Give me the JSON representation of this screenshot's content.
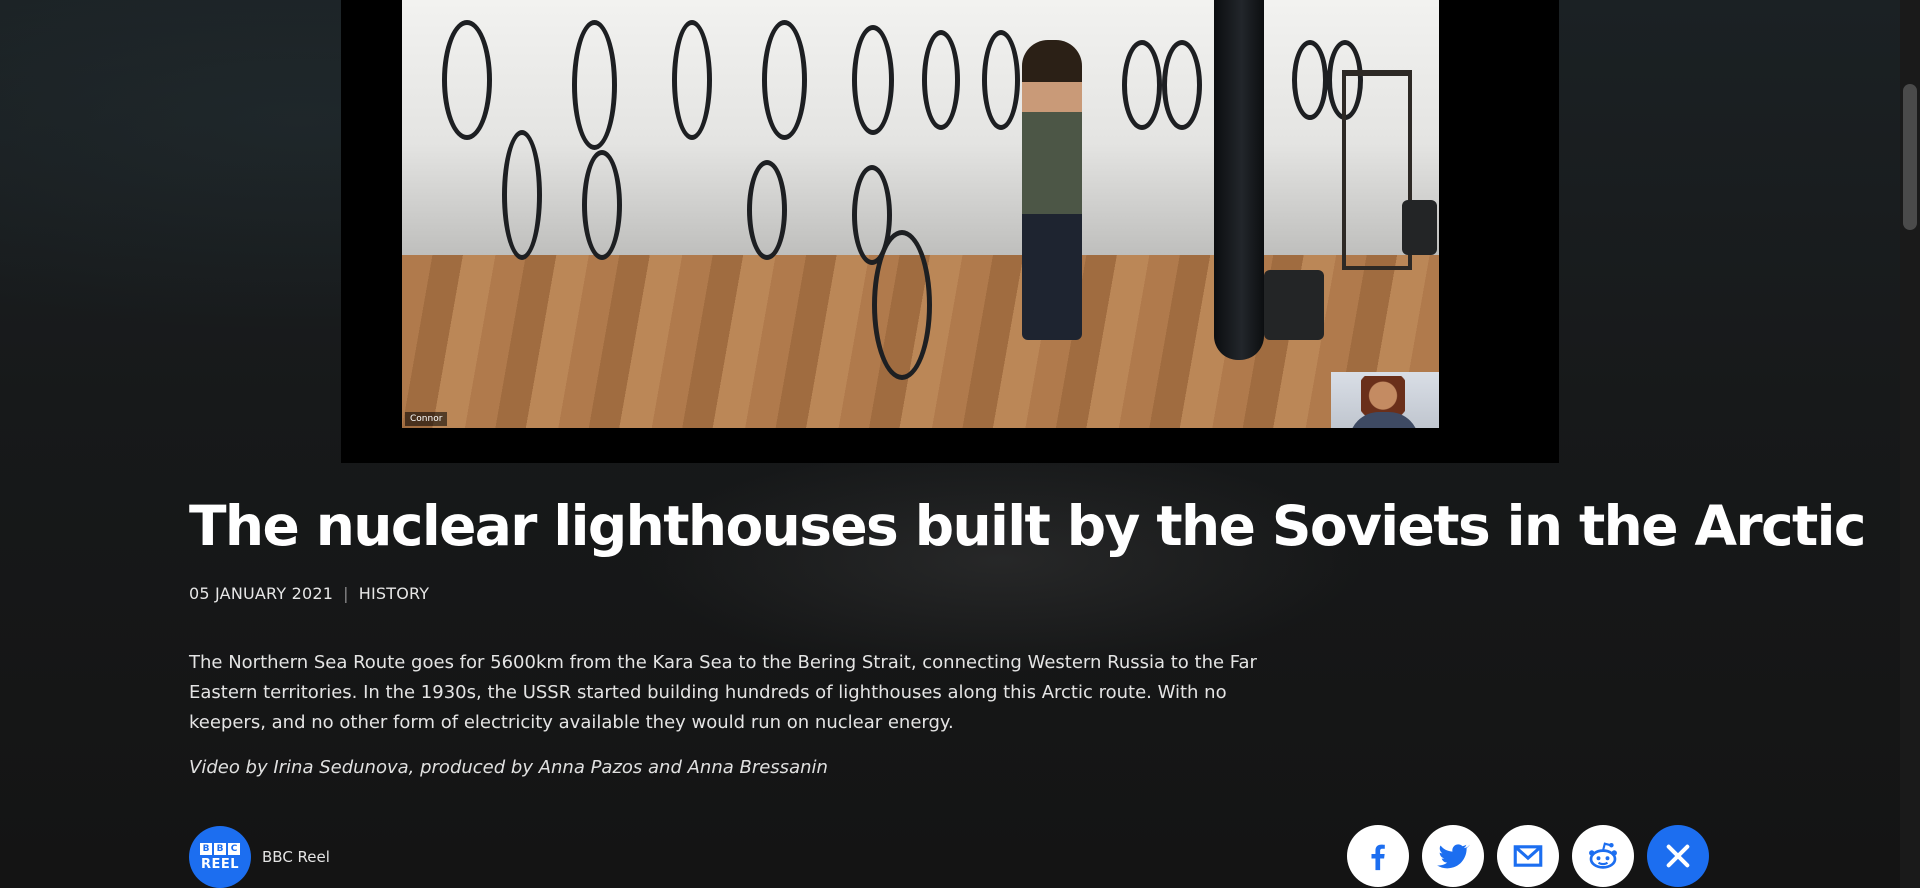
{
  "video": {
    "participant_name": "Connor"
  },
  "article": {
    "title": "The nuclear lighthouses built by the Soviets in the Arctic",
    "date": "05 JANUARY 2021",
    "separator": "|",
    "category": "HISTORY",
    "summary": "The Northern Sea Route goes for 5600km from the Kara Sea to the Bering Strait, connecting Western Russia to the Far Eastern territories. In the 1930s, the USSR started building hundreds of lighthouses along this Arctic route. With no keepers, and no other form of electricity available they would run on nuclear energy.",
    "credit": "Video by Irina Sedunova, produced by Anna Pazos and Anna Bressanin"
  },
  "brand": {
    "logo_letters": [
      "B",
      "B",
      "C"
    ],
    "logo_word": "REEL",
    "name": "BBC Reel"
  },
  "share": {
    "buttons": [
      "facebook-icon",
      "twitter-icon",
      "email-icon",
      "reddit-icon",
      "close-icon"
    ]
  },
  "colors": {
    "accent": "#1c6ef0",
    "background": "#141516",
    "text": "#ffffff"
  }
}
